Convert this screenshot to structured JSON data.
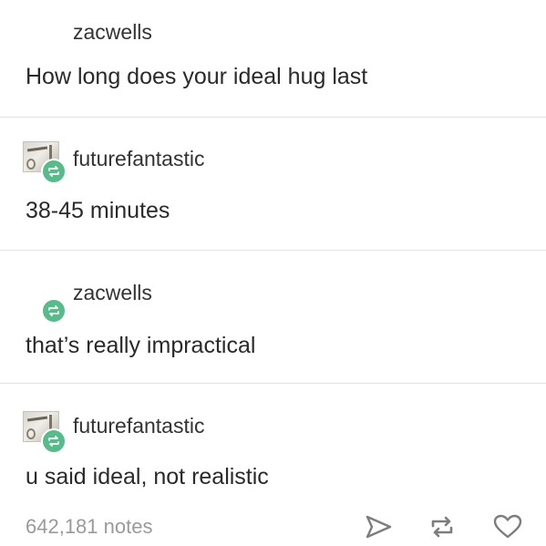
{
  "posts": [
    {
      "username": "zacwells",
      "text": "How long does your ideal hug last"
    },
    {
      "username": "futurefantastic",
      "text": "38-45 minutes"
    },
    {
      "username": "zacwells",
      "text": "that’s really impractical"
    },
    {
      "username": "futurefantastic",
      "text": "u said ideal, not realistic"
    }
  ],
  "footer": {
    "notes": "642,181 notes"
  },
  "icons": {
    "share": "share-icon",
    "reblog": "reblog-icon",
    "like": "heart-icon",
    "avatar_badge": "reblog-badge-icon"
  },
  "colors": {
    "reblog_badge": "#56bc8a",
    "notes_text": "#9a9a9a",
    "divider": "#e4e4e4"
  }
}
